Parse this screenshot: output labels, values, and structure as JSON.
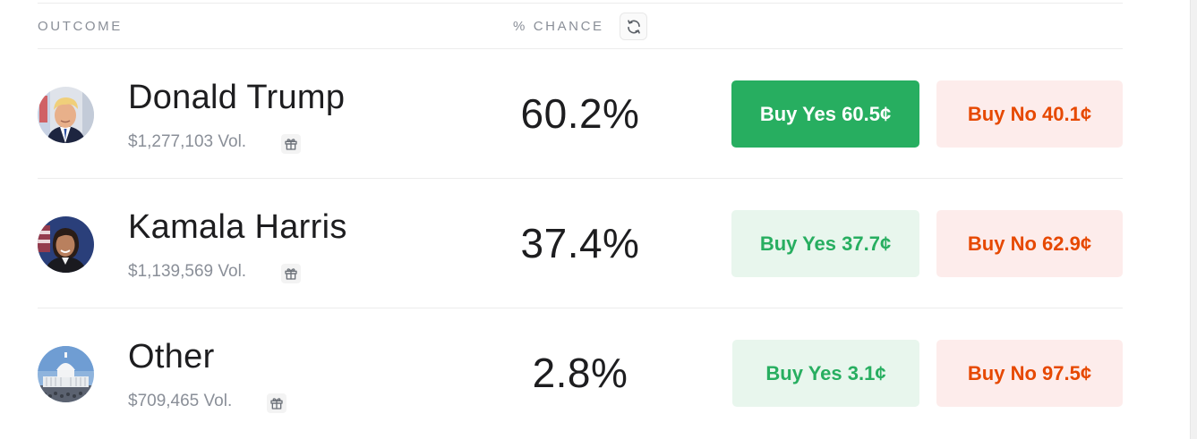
{
  "header": {
    "outcome_label": "OUTCOME",
    "chance_label": "% CHANCE"
  },
  "colors": {
    "yes_solid": "#27ae60",
    "yes_soft_bg": "#e8f6ed",
    "no_soft_bg": "#fdeceb",
    "no_text": "#e64800",
    "muted_text": "#8a8f98"
  },
  "icons": {
    "refresh": "refresh-icon",
    "gift": "gift-icon"
  },
  "outcomes": [
    {
      "name": "Donald Trump",
      "volume": "$1,277,103 Vol.",
      "chance": "60.2%",
      "buy_yes": "Buy Yes 60.5¢",
      "buy_no": "Buy No 40.1¢"
    },
    {
      "name": "Kamala Harris",
      "volume": "$1,139,569 Vol.",
      "chance": "37.4%",
      "buy_yes": "Buy Yes 37.7¢",
      "buy_no": "Buy No 62.9¢"
    },
    {
      "name": "Other",
      "volume": "$709,465 Vol.",
      "chance": "2.8%",
      "buy_yes": "Buy Yes 3.1¢",
      "buy_no": "Buy No 97.5¢"
    }
  ]
}
